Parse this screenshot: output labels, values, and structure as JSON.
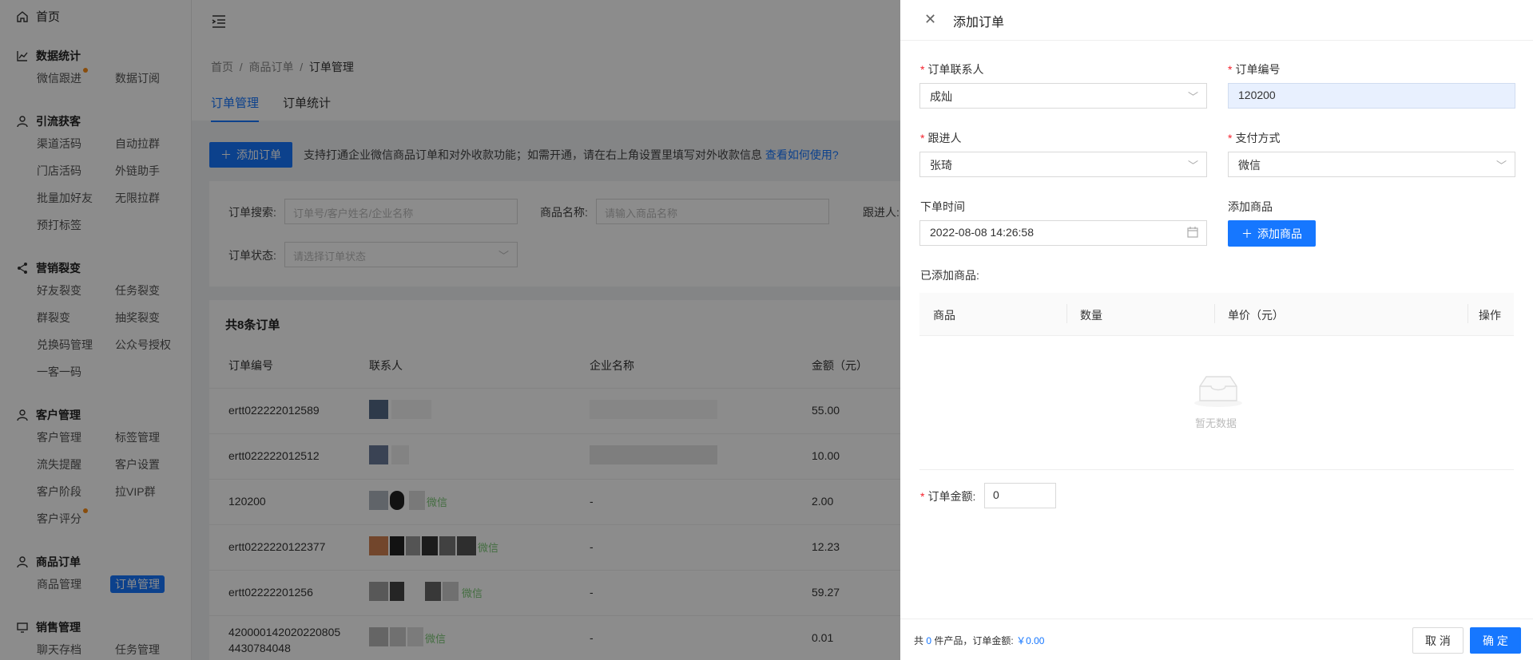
{
  "sidebar": {
    "home": "首页",
    "groups": [
      {
        "title": "数据统计",
        "items": [
          "微信跟进",
          "数据订阅"
        ]
      },
      {
        "title": "引流获客",
        "items": [
          "渠道活码",
          "自动拉群",
          "门店活码",
          "外链助手",
          "批量加好友",
          "无限拉群",
          "预打标签"
        ]
      },
      {
        "title": "营销裂变",
        "items": [
          "好友裂变",
          "任务裂变",
          "群裂变",
          "抽奖裂变",
          "兑换码管理",
          "公众号授权",
          "一客一码"
        ]
      },
      {
        "title": "客户管理",
        "items": [
          "客户管理",
          "标签管理",
          "流失提醒",
          "客户设置",
          "客户阶段",
          "拉VIP群",
          "客户评分"
        ]
      },
      {
        "title": "商品订单",
        "items": [
          "商品管理",
          "订单管理"
        ]
      },
      {
        "title": "销售管理",
        "items": [
          "聊天存档",
          "任务管理"
        ]
      }
    ]
  },
  "breadcrumb": {
    "a": "首页",
    "b": "商品订单",
    "c": "订单管理"
  },
  "tabs": [
    "订单管理",
    "订单统计"
  ],
  "add_order_btn": "添加订单",
  "notice": "支持打通企业微信商品订单和对外收款功能；如需开通，请在右上角设置里填写对外收款信息",
  "notice_link": "查看如何使用?",
  "filter": {
    "search_label": "订单搜索:",
    "search_ph": "订单号/客户姓名/企业名称",
    "goods_label": "商品名称:",
    "goods_ph": "请输入商品名称",
    "follow_label": "跟进人:",
    "status_label": "订单状态:",
    "status_ph": "请选择订单状态"
  },
  "table": {
    "title": "共8条订单",
    "headers": [
      "订单编号",
      "联系人",
      "企业名称",
      "金额（元）"
    ],
    "rows": [
      {
        "no": "ertt022222012589",
        "wx": "",
        "company": "",
        "amount": "55.00"
      },
      {
        "no": "ertt022222012512",
        "wx": "",
        "company": "",
        "amount": "10.00"
      },
      {
        "no": "120200",
        "wx": "微信",
        "company": "-",
        "amount": "2.00"
      },
      {
        "no": "ertt0222220122377",
        "wx": "微信",
        "company": "-",
        "amount": "12.23"
      },
      {
        "no": "ertt02222201256",
        "wx": "微信",
        "company": "-",
        "amount": "59.27"
      },
      {
        "no": "420000142020220805",
        "no2": "4430784048",
        "wx": "微信",
        "company": "-",
        "amount": "0.01"
      }
    ]
  },
  "drawer": {
    "title": "添加订单",
    "contact_label": "订单联系人",
    "contact_value": "成灿",
    "order_no_label": "订单编号",
    "order_no_value": "120200",
    "follower_label": "跟进人",
    "follower_value": "张琦",
    "pay_label": "支付方式",
    "pay_value": "微信",
    "time_label": "下单时间",
    "time_value": "2022-08-08 14:26:58",
    "add_goods_label": "添加商品",
    "add_goods_btn": "添加商品",
    "added_label": "已添加商品:",
    "goods_headers": [
      "商品",
      "数量",
      "单价（元）",
      "操作"
    ],
    "empty_text": "暂无数据",
    "amount_label": "订单金额:",
    "amount_value": "0",
    "footer_pre": "共",
    "footer_count": "0",
    "footer_mid": "件产品，订单金额:",
    "footer_total": "￥0.00",
    "cancel": "取 消",
    "ok": "确 定"
  }
}
